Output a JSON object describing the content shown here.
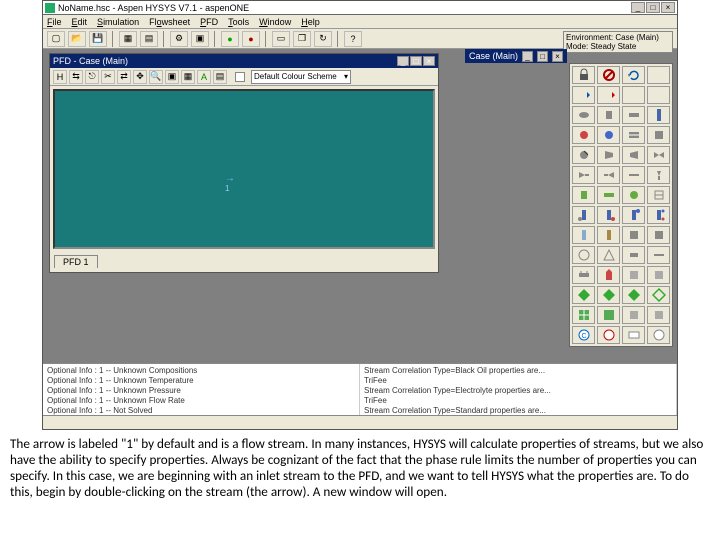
{
  "window": {
    "title": "NoName.hsc - Aspen HYSYS V7.1 - aspenONE",
    "min": "_",
    "max": "□",
    "close": "×"
  },
  "menu": [
    "File",
    "Edit",
    "Simulation",
    "Flowsheet",
    "PFD",
    "Tools",
    "Window",
    "Help"
  ],
  "env": {
    "l1": "Environment: Case (Main)",
    "l2": "Mode: Steady State"
  },
  "casebar": {
    "label": "Case (Main)",
    "min": "_",
    "max": "□",
    "close": "×"
  },
  "pfd": {
    "title": "PFD - Case (Main)",
    "combo": "Default Colour Scheme",
    "stream_label": "1",
    "tab": "PFD 1"
  },
  "log": {
    "left": [
      "Optional Info :  1 -- Unknown Compositions",
      "Optional Info :  1 -- Unknown Temperature",
      "Optional Info :  1 -- Unknown Pressure",
      "Optional Info :  1 -- Unknown Flow Rate",
      "Optional Info :  1 -- Not Solved"
    ],
    "right": [
      "Stream Correlation Type=Black Oil   properties are...",
      "TriFee",
      "Stream Correlation Type=Electrolyte   properties are...",
      "TriFee",
      "Stream Correlation Type=Standard   properties are..."
    ]
  },
  "caption": "The arrow is labeled \"1\" by default and is a flow stream. In many instances, HYSYS will calculate properties of streams, but we also have the ability to specify properties. Always be cognizant of the fact that the phase rule limits the number of properties you can specify. In this case, we are beginning with an inlet stream to the PFD, and we want to tell HYSYS what the properties are. To do this, begin by double-clicking on the stream (the arrow). A new window will open."
}
